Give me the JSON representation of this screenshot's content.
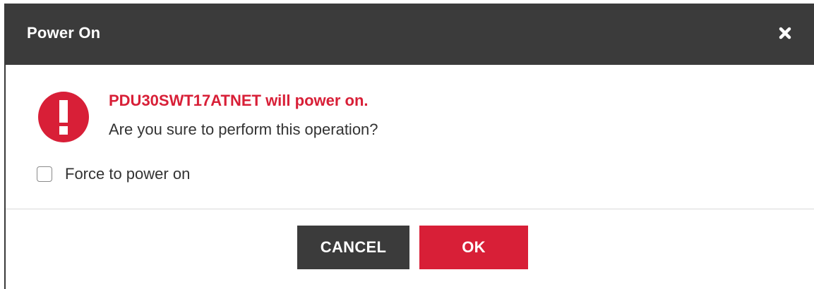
{
  "dialog": {
    "title": "Power On",
    "close_icon": "close-icon",
    "alert_icon": "exclamation-circle-icon",
    "message_title": "PDU30SWT17ATNET will power on.",
    "message_text": "Are you sure to perform this operation?",
    "force_checkbox": {
      "label": "Force to power on",
      "checked": false
    },
    "buttons": {
      "cancel_label": "CANCEL",
      "ok_label": "OK"
    }
  },
  "colors": {
    "header_bg": "#3b3b3b",
    "accent_red": "#d81f37",
    "text": "#333333"
  }
}
